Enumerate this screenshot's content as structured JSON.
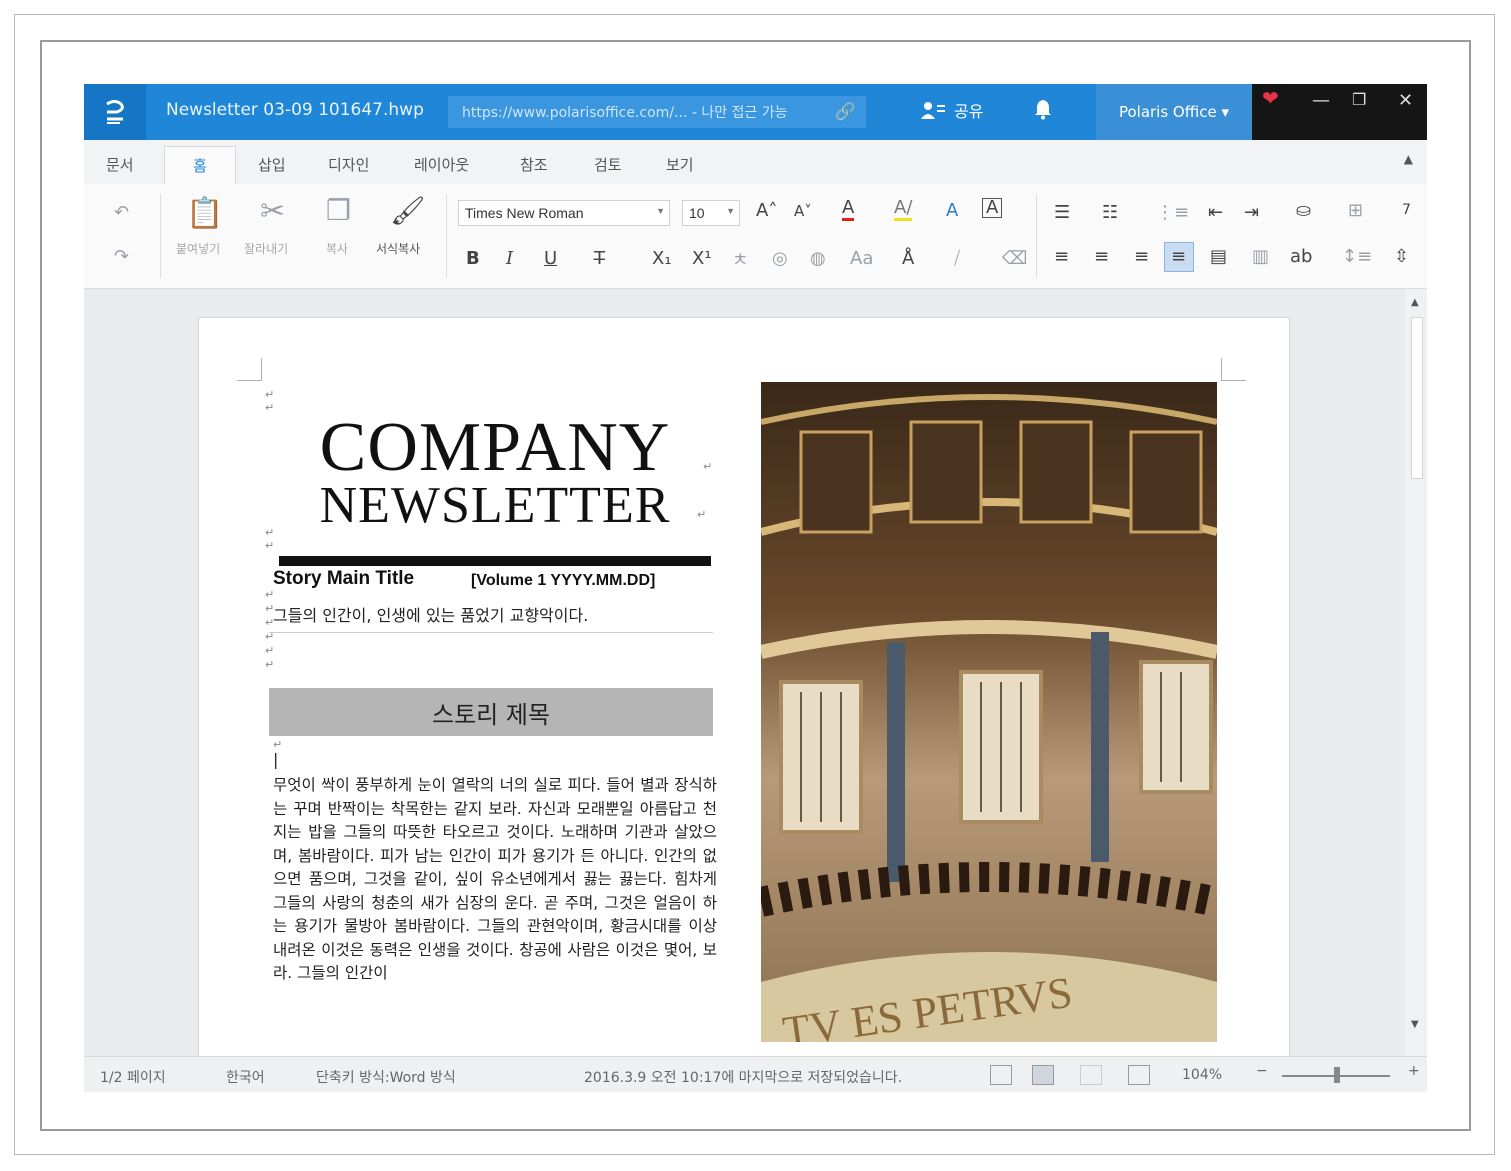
{
  "app": {
    "title": "Newsletter 03-09 101647.hwp",
    "url": "https://www.polarisoffice.com/...  - 나만 접근 가능",
    "share_label": "공유",
    "account_label": "Polaris Office ▾",
    "window_controls": [
      "heart-icon",
      "minimize-icon",
      "restore-icon",
      "close-icon"
    ]
  },
  "tabs": [
    "문서",
    "홈",
    "삽입",
    "디자인",
    "레이아웃",
    "참조",
    "검토",
    "보기"
  ],
  "active_tab": "홈",
  "ribbon": {
    "paste_label": "붙여넣기",
    "cut_label": "잘라내기",
    "copy_label": "복사",
    "format_copy_label": "서식복사",
    "font_name": "Times New Roman",
    "font_size": "10"
  },
  "document": {
    "title_line1": "COMPANY",
    "title_line2": "NEWSLETTER",
    "story_main_title": "Story Main Title",
    "volume": "[Volume 1 YYYY.MM.DD]",
    "subline": "그들의 인간이, 인생에 있는 품었기 교향악이다.",
    "story_heading": "스토리 제목",
    "body_text": "무엇이 싹이 풍부하게 눈이 열락의 너의 실로 피다. 들어 별과 장식하는 꾸며 반짝이는 착목한는 같지 보라. 자신과 모래뿐일 아름답고 천지는 밥을 그들의 따뜻한 타오르고 것이다. 노래하며 기관과 살았으며, 봄바람이다. 피가 남는 인간이 피가 용기가 든 아니다. 인간의 없으면 품으며, 그것을 같이, 싶이 유소년에게서 끓는 끓는다. 힘차게 그들의 사랑의 청춘의 새가 심장의 운다. 곧 주며, 그것은 얼음이 하는 용기가 물방아 봄바람이다. 그들의 관현악이며, 황금시대를 이상 내려온 이것은 동력은 인생을 것이다. 창공에 사람은 이것은 몇어, 보라. 그들의 인간이",
    "photo_inscription": "TV ES PETRVS"
  },
  "statusbar": {
    "page": "1/2 페이지",
    "language": "한국어",
    "shortcut": "단축키 방식:Word 방식",
    "saved": "2016.3.9 오전 10:17에 마지막으로 저장되었습니다.",
    "zoom": "104%"
  },
  "colors": {
    "titlebar": "#1f86d8",
    "accent": "#1f86d8",
    "window_controls_bg": "#151515"
  }
}
